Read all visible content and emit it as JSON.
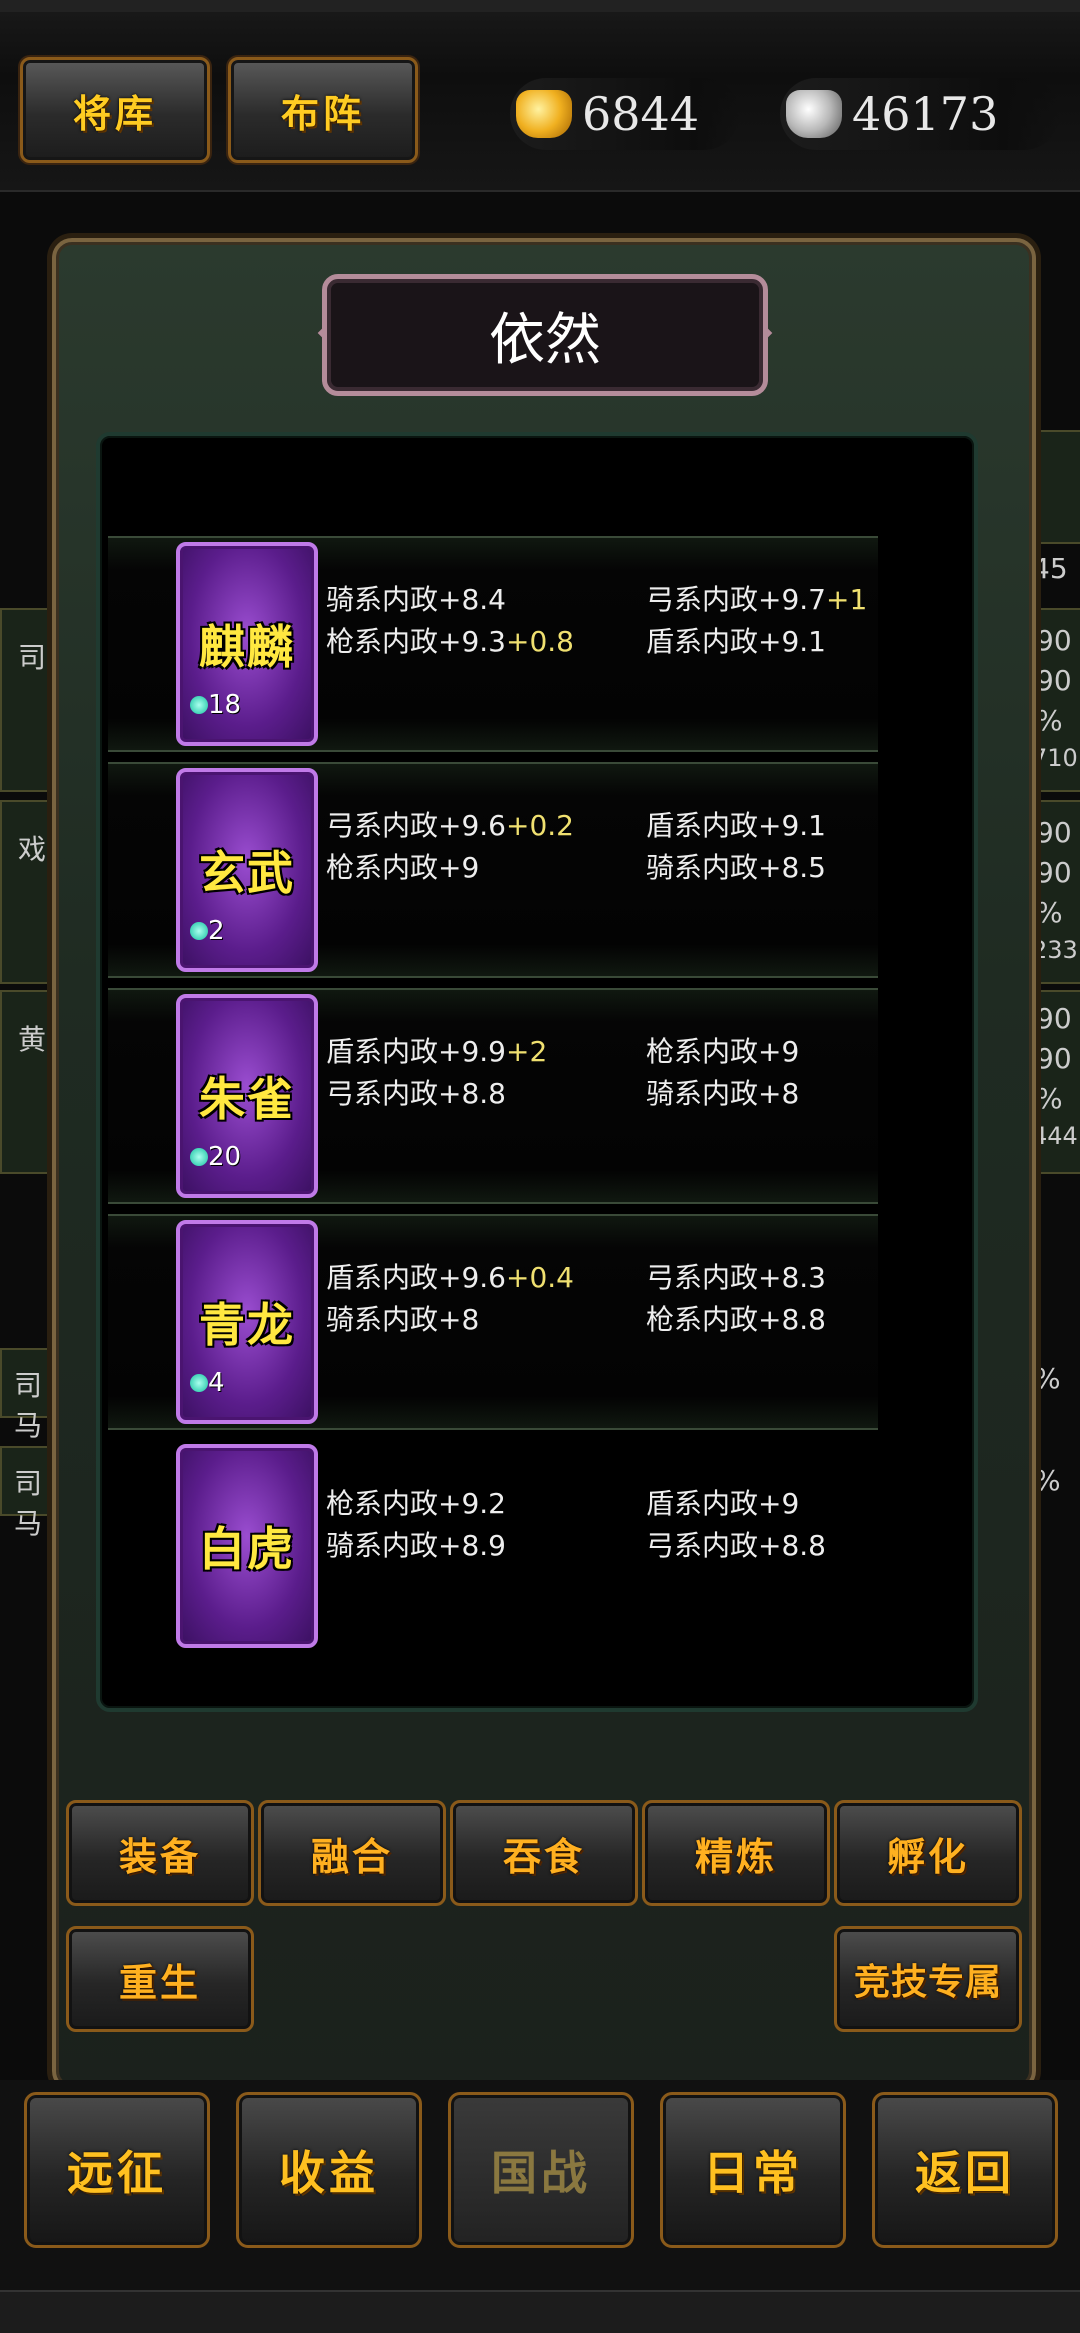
{
  "top": {
    "buttons": [
      "将库",
      "布阵"
    ],
    "gold": "6844",
    "silver": "46173"
  },
  "background": {
    "left_names": [
      "司",
      "戏",
      "黄"
    ],
    "left_rows": [
      "司马",
      "司马"
    ],
    "right_values": [
      "45",
      "90",
      "90",
      "%",
      "710",
      "90",
      "90",
      "%",
      "233",
      "90",
      "90",
      "%",
      "444",
      "%",
      "%"
    ]
  },
  "panel": {
    "title": "依然"
  },
  "items": [
    {
      "name": "麒麟",
      "gems": "18",
      "stat1": "骑系内政+8.4",
      "stat1_bonus": "",
      "stat2": "弓系内政+9.7",
      "stat2_bonus": "+1",
      "stat3": "枪系内政+9.3",
      "stat3_bonus": "+0.8",
      "stat4": "盾系内政+9.1",
      "stat4_bonus": ""
    },
    {
      "name": "玄武",
      "gems": "2",
      "stat1": "弓系内政+9.6",
      "stat1_bonus": "+0.2",
      "stat2": "盾系内政+9.1",
      "stat2_bonus": "",
      "stat3": "枪系内政+9",
      "stat3_bonus": "",
      "stat4": "骑系内政+8.5",
      "stat4_bonus": ""
    },
    {
      "name": "朱雀",
      "gems": "20",
      "stat1": "盾系内政+9.9",
      "stat1_bonus": "+2",
      "stat2": "枪系内政+9",
      "stat2_bonus": "",
      "stat3": "弓系内政+8.8",
      "stat3_bonus": "",
      "stat4": "骑系内政+8",
      "stat4_bonus": ""
    },
    {
      "name": "青龙",
      "gems": "4",
      "stat1": "盾系内政+9.6",
      "stat1_bonus": "+0.4",
      "stat2": "弓系内政+8.3",
      "stat2_bonus": "",
      "stat3": "骑系内政+8",
      "stat3_bonus": "",
      "stat4": "枪系内政+8.8",
      "stat4_bonus": ""
    },
    {
      "name": "白虎",
      "gems": "",
      "stat1": "枪系内政+9.2",
      "stat1_bonus": "",
      "stat2": "盾系内政+9",
      "stat2_bonus": "",
      "stat3": "骑系内政+8.9",
      "stat3_bonus": "",
      "stat4": "弓系内政+8.8",
      "stat4_bonus": ""
    }
  ],
  "actions": {
    "row1": [
      "装备",
      "融合",
      "吞食",
      "精炼",
      "孵化"
    ],
    "rebirth": "重生",
    "arena": "竞技专属"
  },
  "nav": [
    "远征",
    "收益",
    "国战",
    "日常",
    "返回"
  ]
}
